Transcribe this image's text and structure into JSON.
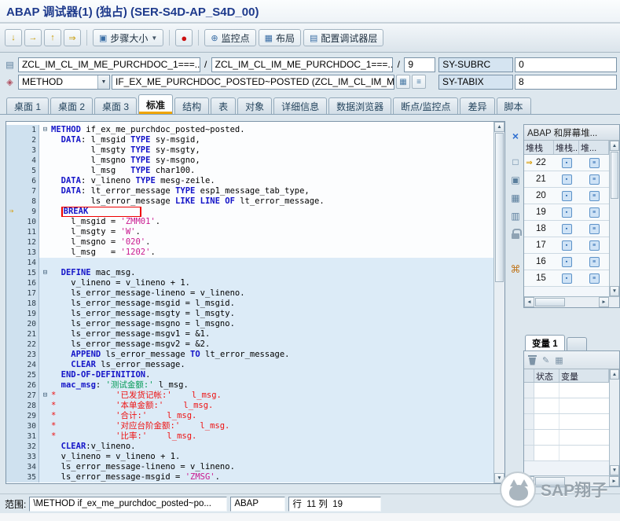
{
  "window": {
    "title": "ABAP 调试器(1) (独占) (SER-S4D-AP_S4D_00)"
  },
  "icons": {
    "step_into": "↓",
    "execute": "→",
    "return": "↑",
    "continue": "⇒",
    "caret_down": "▼",
    "stop": "●",
    "watchpoint": "⊕",
    "layout": "▦",
    "configure": "▤",
    "step_size": "▣",
    "close": "×",
    "page": "□",
    "copy": "▣",
    "grid": "▦",
    "grid2": "▥",
    "session": "⌘",
    "source": "▤",
    "event": "◈",
    "display": "▦",
    "goto": "≡",
    "pencil": "✎",
    "up": "▲",
    "down": "▼",
    "left": "◄",
    "right": "►",
    "fold": "⊟",
    "exec_arrow": "⇒",
    "stack_icon": "▪",
    "abap_icon": "≡"
  },
  "toolbar": {
    "step_size_label": "步骤大小",
    "watchpoint_label": "监控点",
    "layout_label": "布局",
    "configure_label": "配置调试器层"
  },
  "context": {
    "program": "ZCL_IM_CL_IM_ME_PURCHDOC_1===...",
    "include": "ZCL_IM_CL_IM_ME_PURCHDOC_1===...",
    "slash": "/",
    "line": "9",
    "sy_subrc_label": "SY-SUBRC",
    "sy_subrc_value": "0",
    "event_type": "METHOD",
    "event_name": "IF_EX_ME_PURCHDOC_POSTED~POSTED (ZCL_IM_CL_IM_ME_...",
    "sy_tabix_label": "SY-TABIX",
    "sy_tabix_value": "8"
  },
  "tabs": [
    {
      "id": "desktop-1",
      "label": "桌面 1"
    },
    {
      "id": "desktop-2",
      "label": "桌面 2"
    },
    {
      "id": "desktop-3",
      "label": "桌面 3"
    },
    {
      "id": "standard",
      "label": "标准",
      "active": true
    },
    {
      "id": "structures",
      "label": "结构"
    },
    {
      "id": "tables",
      "label": "表"
    },
    {
      "id": "objects",
      "label": "对象"
    },
    {
      "id": "detail",
      "label": "详细信息"
    },
    {
      "id": "data-explorer",
      "label": "数据浏览器"
    },
    {
      "id": "breakpoints",
      "label": "断点/监控点"
    },
    {
      "id": "diff",
      "label": "差异"
    },
    {
      "id": "script",
      "label": "脚本"
    }
  ],
  "editor": {
    "lines": [
      {
        "n": 1,
        "fold": true,
        "seg": [
          [
            "k",
            "METHOD"
          ],
          [
            "p",
            " if_ex_me_purchdoc_posted~posted."
          ]
        ]
      },
      {
        "n": 2,
        "seg": [
          [
            "p",
            "  "
          ],
          [
            "k",
            "DATA"
          ],
          [
            "p",
            ": l_msgid "
          ],
          [
            "k",
            "TYPE"
          ],
          [
            "p",
            " sy-msgid,"
          ]
        ]
      },
      {
        "n": 3,
        "seg": [
          [
            "p",
            "        l_msgty "
          ],
          [
            "k",
            "TYPE"
          ],
          [
            "p",
            " sy-msgty,"
          ]
        ]
      },
      {
        "n": 4,
        "seg": [
          [
            "p",
            "        l_msgno "
          ],
          [
            "k",
            "TYPE"
          ],
          [
            "p",
            " sy-msgno,"
          ]
        ]
      },
      {
        "n": 5,
        "seg": [
          [
            "p",
            "        l_msg   "
          ],
          [
            "k",
            "TYPE"
          ],
          [
            "p",
            " char100."
          ]
        ]
      },
      {
        "n": 6,
        "seg": [
          [
            "p",
            "  "
          ],
          [
            "k",
            "DATA"
          ],
          [
            "p",
            ": v_lineno "
          ],
          [
            "k",
            "TYPE"
          ],
          [
            "p",
            " mesg-zeile."
          ]
        ]
      },
      {
        "n": 7,
        "seg": [
          [
            "p",
            "  "
          ],
          [
            "k",
            "DATA"
          ],
          [
            "p",
            ": lt_error_message "
          ],
          [
            "k",
            "TYPE"
          ],
          [
            "p",
            " esp1_message_tab_type,"
          ]
        ]
      },
      {
        "n": 8,
        "seg": [
          [
            "p",
            "        ls_error_message "
          ],
          [
            "k",
            "LIKE LINE OF"
          ],
          [
            "p",
            " lt_error_message."
          ]
        ]
      },
      {
        "n": 9,
        "arrow": true,
        "box": true,
        "seg": [
          [
            "p",
            "  "
          ],
          [
            "k",
            "BREAK"
          ]
        ]
      },
      {
        "n": 10,
        "seg": [
          [
            "p",
            "    l_msgid = "
          ],
          [
            "s",
            "'ZMM01'"
          ],
          [
            "p",
            "."
          ]
        ]
      },
      {
        "n": 11,
        "seg": [
          [
            "p",
            "    l_msgty = "
          ],
          [
            "s",
            "'W'"
          ],
          [
            "p",
            "."
          ]
        ]
      },
      {
        "n": 12,
        "seg": [
          [
            "p",
            "    l_msgno = "
          ],
          [
            "s",
            "'020'"
          ],
          [
            "p",
            "."
          ]
        ]
      },
      {
        "n": 13,
        "seg": [
          [
            "p",
            "    l_msg   = "
          ],
          [
            "s",
            "'1202'"
          ],
          [
            "p",
            "."
          ]
        ]
      },
      {
        "n": 14,
        "seg": []
      },
      {
        "n": 15,
        "fold": true,
        "seg": [
          [
            "p",
            "  "
          ],
          [
            "k",
            "DEFINE"
          ],
          [
            "p",
            " mac_msg."
          ]
        ]
      },
      {
        "n": 16,
        "seg": [
          [
            "p",
            "    v_lineno = v_lineno + 1."
          ]
        ]
      },
      {
        "n": 17,
        "seg": [
          [
            "p",
            "    ls_error_message-lineno = v_lineno."
          ]
        ]
      },
      {
        "n": 18,
        "seg": [
          [
            "p",
            "    ls_error_message-msgid = l_msgid."
          ]
        ]
      },
      {
        "n": 19,
        "seg": [
          [
            "p",
            "    ls_error_message-msgty = l_msgty."
          ]
        ]
      },
      {
        "n": 20,
        "seg": [
          [
            "p",
            "    ls_error_message-msgno = l_msgno."
          ]
        ]
      },
      {
        "n": 21,
        "seg": [
          [
            "p",
            "    ls_error_message-msgv1 = &1."
          ]
        ]
      },
      {
        "n": 22,
        "seg": [
          [
            "p",
            "    ls_error_message-msgv2 = &2."
          ]
        ]
      },
      {
        "n": 23,
        "seg": [
          [
            "p",
            "    "
          ],
          [
            "k",
            "APPEND"
          ],
          [
            "p",
            " ls_error_message "
          ],
          [
            "k",
            "TO"
          ],
          [
            "p",
            " lt_error_message."
          ]
        ]
      },
      {
        "n": 24,
        "seg": [
          [
            "p",
            "    "
          ],
          [
            "k",
            "CLEAR"
          ],
          [
            "p",
            " ls_error_message."
          ]
        ]
      },
      {
        "n": 25,
        "seg": [
          [
            "p",
            "  "
          ],
          [
            "k",
            "END-OF-DEFINITION"
          ],
          [
            "p",
            "."
          ]
        ]
      },
      {
        "n": 26,
        "seg": [
          [
            "p",
            "  "
          ],
          [
            "k",
            "mac_msg"
          ],
          [
            "p",
            ": "
          ],
          [
            "g",
            "'测试金额:'"
          ],
          [
            "p",
            " l_msg."
          ]
        ]
      },
      {
        "n": 27,
        "fold": true,
        "seg": [
          [
            "c",
            "*            '已发货记帐:'    l_msg."
          ]
        ]
      },
      {
        "n": 28,
        "seg": [
          [
            "c",
            "*            '本单金额:'    l_msg."
          ]
        ]
      },
      {
        "n": 29,
        "seg": [
          [
            "c",
            "*            '合计:'    l_msg."
          ]
        ]
      },
      {
        "n": 30,
        "seg": [
          [
            "c",
            "*            '对应台阶金额:'    l_msg."
          ]
        ]
      },
      {
        "n": 31,
        "seg": [
          [
            "c",
            "*            '比率:'    l_msg."
          ]
        ]
      },
      {
        "n": 32,
        "seg": [
          [
            "p",
            "  "
          ],
          [
            "k",
            "CLEAR"
          ],
          [
            "p",
            ":v_lineno."
          ]
        ]
      },
      {
        "n": 33,
        "seg": [
          [
            "p",
            "  v_lineno = v_lineno + 1."
          ]
        ]
      },
      {
        "n": 34,
        "seg": [
          [
            "p",
            "  ls_error_message-lineno = v_lineno."
          ]
        ]
      },
      {
        "n": 35,
        "seg": [
          [
            "p",
            "  ls_error_message-msgid = "
          ],
          [
            "s",
            "'ZMSG'"
          ],
          [
            "p",
            "."
          ]
        ]
      }
    ]
  },
  "stack_panel": {
    "title": "ABAP 和屏幕堆...",
    "columns": [
      "堆栈",
      "堆栈...",
      "堆..."
    ],
    "rows": [
      {
        "level": "22",
        "current": true
      },
      {
        "level": "21"
      },
      {
        "level": "20"
      },
      {
        "level": "19"
      },
      {
        "level": "18"
      },
      {
        "level": "17"
      },
      {
        "level": "16"
      },
      {
        "level": "15"
      }
    ]
  },
  "variables_panel": {
    "tab_label": "变量 1",
    "columns": [
      "状态",
      "变量"
    ],
    "empty_rows": 5
  },
  "statusbar": {
    "scope_label": "范围:",
    "scope_value": "\\METHOD if_ex_me_purchdoc_posted~po...",
    "language": "ABAP",
    "position": "行  11 列  19"
  },
  "watermark": {
    "text": "SAP翔子"
  }
}
